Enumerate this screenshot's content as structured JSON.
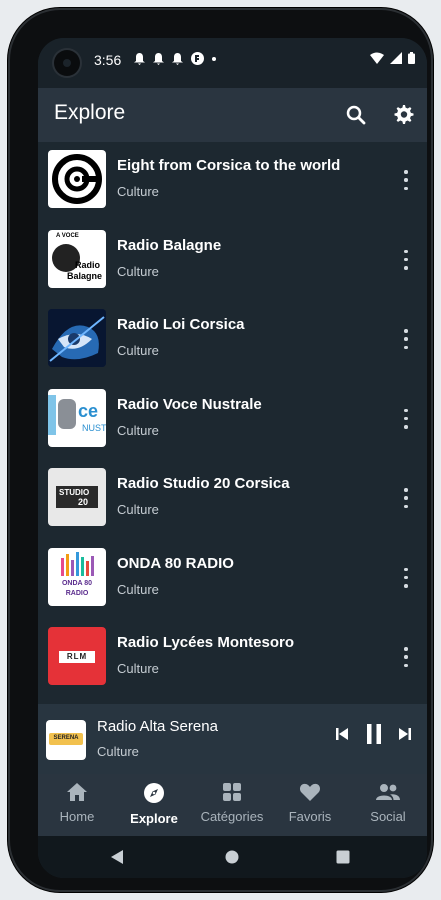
{
  "status_bar": {
    "time": "3:56"
  },
  "app_bar": {
    "title": "Explore"
  },
  "stations": [
    {
      "name": "Eight from Corsica to the world",
      "category": "Culture",
      "logo": "eight-logo"
    },
    {
      "name": "Radio Balagne",
      "category": "Culture",
      "logo": "radio-balagne-logo",
      "logo_text_1": "A VOCE",
      "logo_text_2": "Radio",
      "logo_text_3": "Balagne"
    },
    {
      "name": "Radio Loi Corsica",
      "category": "Culture",
      "logo": "radio-loi-corsica-logo"
    },
    {
      "name": "Radio Voce Nustrale",
      "category": "Culture",
      "logo": "voce-nustrale-logo",
      "logo_text_1": "ce",
      "logo_text_2": "NUST"
    },
    {
      "name": "Radio Studio 20 Corsica",
      "category": "Culture",
      "logo": "studio-20-logo",
      "logo_text_1": "STUDIO",
      "logo_text_2": "20"
    },
    {
      "name": "ONDA 80 RADIO",
      "category": "Culture",
      "logo": "onda-80-logo",
      "logo_text_1": "ONDA 80",
      "logo_text_2": "RADIO"
    },
    {
      "name": "Radio Lycées Montesoro",
      "category": "Culture",
      "logo": "rlm-logo",
      "logo_text_1": "RLM"
    }
  ],
  "now_playing": {
    "title": "Radio Alta Serena",
    "category": "Culture",
    "logo_text": "SERENA"
  },
  "bottom_nav": [
    {
      "label": "Home",
      "icon": "home-icon",
      "active": false
    },
    {
      "label": "Explore",
      "icon": "compass-icon",
      "active": true
    },
    {
      "label": "Catégories",
      "icon": "grid-icon",
      "active": false
    },
    {
      "label": "Favoris",
      "icon": "heart-icon",
      "active": false
    },
    {
      "label": "Social",
      "icon": "people-icon",
      "active": false
    }
  ],
  "colors": {
    "background": "#1d2830",
    "app_bar": "#2a3540",
    "accent_red": "#e53238"
  }
}
